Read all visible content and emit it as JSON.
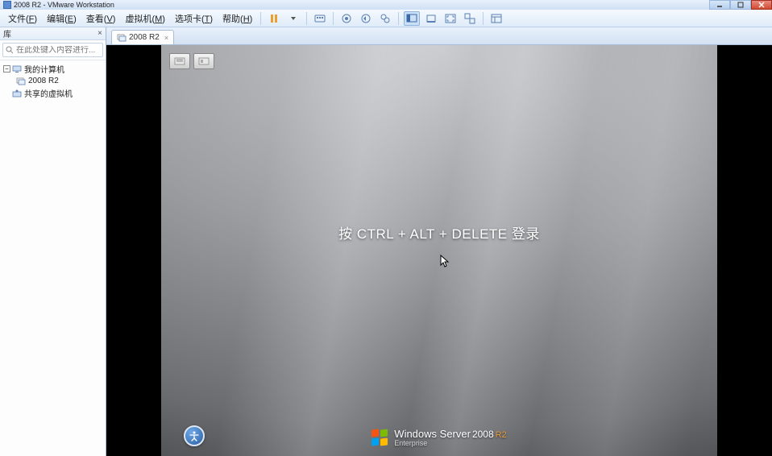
{
  "titlebar": {
    "text": "2008 R2 - VMware Workstation"
  },
  "menu": {
    "items": [
      {
        "label": "文件",
        "accel": "F"
      },
      {
        "label": "编辑",
        "accel": "E"
      },
      {
        "label": "查看",
        "accel": "V"
      },
      {
        "label": "虚拟机",
        "accel": "M"
      },
      {
        "label": "选项卡",
        "accel": "T"
      },
      {
        "label": "帮助",
        "accel": "H"
      }
    ]
  },
  "library": {
    "title": "库",
    "search_placeholder": "在此处键入内容进行...",
    "tree": {
      "root": "我的计算机",
      "vm": "2008 R2",
      "shared": "共享的虚拟机"
    }
  },
  "tabs": [
    {
      "label": "2008 R2"
    }
  ],
  "vm": {
    "login_prompt": "按 CTRL + ALT + DELETE 登录",
    "brand_main": "Windows Server",
    "brand_year": "2008",
    "brand_suffix": "R2",
    "brand_edition": "Enterprise"
  }
}
